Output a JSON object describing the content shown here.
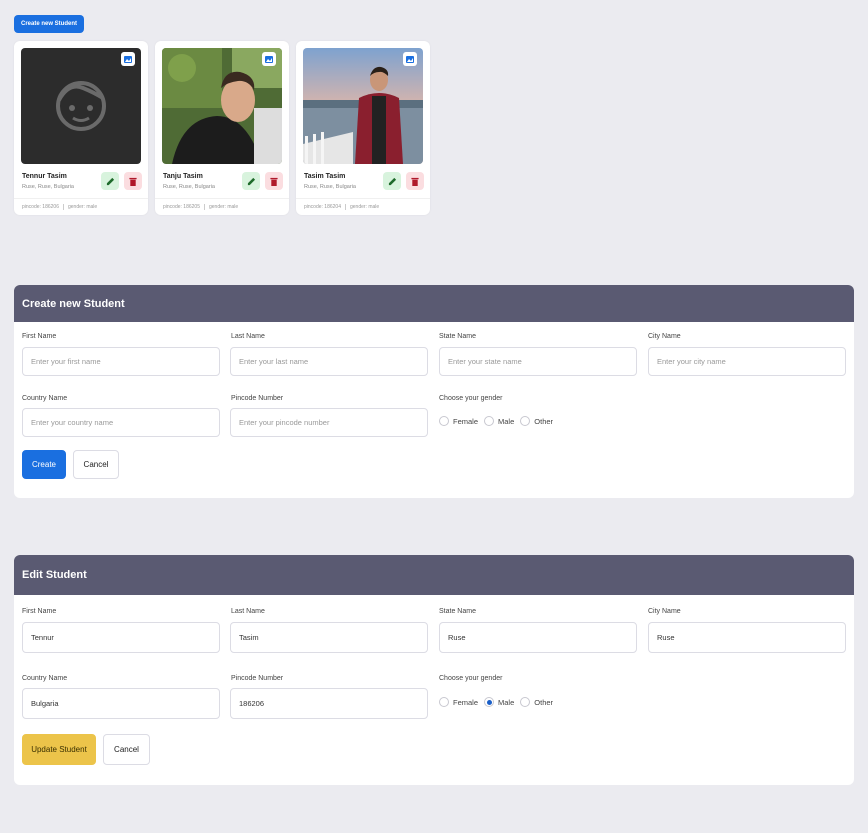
{
  "header_button": "Create new Student",
  "students": [
    {
      "name": "Tennur Tasim",
      "address": "Ruse, Ruse, Bulgaria",
      "pincode": "pincode: 186206",
      "gender": "gender: male"
    },
    {
      "name": "Tanju Tasim",
      "address": "Ruse, Ruse, Bulgaria",
      "pincode": "pincode: 186205",
      "gender": "gender: male"
    },
    {
      "name": "Tasim Tasim",
      "address": "Ruse, Ruse, Bulgaria",
      "pincode": "pincode: 186204",
      "gender": "gender: male"
    }
  ],
  "create_form": {
    "title": "Create new Student",
    "first_name": {
      "label": "First Name",
      "placeholder": "Enter your first name",
      "value": ""
    },
    "last_name": {
      "label": "Last Name",
      "placeholder": "Enter your last name",
      "value": ""
    },
    "state_name": {
      "label": "State Name",
      "placeholder": "Enter your state name",
      "value": ""
    },
    "city_name": {
      "label": "City Name",
      "placeholder": "Enter your city name",
      "value": ""
    },
    "country_name": {
      "label": "Country Name",
      "placeholder": "Enter your country name",
      "value": ""
    },
    "pincode": {
      "label": "Pincode Number",
      "placeholder": "Enter your pincode number",
      "value": ""
    },
    "gender_label": "Choose your gender",
    "gender_options": [
      "Female",
      "Male",
      "Other"
    ],
    "gender_selected": "",
    "submit_label": "Create",
    "cancel_label": "Cancel"
  },
  "edit_form": {
    "title": "Edit Student",
    "first_name": {
      "label": "First Name",
      "value": "Tennur"
    },
    "last_name": {
      "label": "Last Name",
      "value": "Tasim"
    },
    "state_name": {
      "label": "State Name",
      "value": "Ruse"
    },
    "city_name": {
      "label": "City Name",
      "value": "Ruse"
    },
    "country_name": {
      "label": "Country Name",
      "value": "Bulgaria"
    },
    "pincode": {
      "label": "Pincode Number",
      "value": "186206"
    },
    "gender_label": "Choose your gender",
    "gender_options": [
      "Female",
      "Male",
      "Other"
    ],
    "gender_selected": "Male",
    "submit_label": "Update Student",
    "cancel_label": "Cancel"
  },
  "colors": {
    "primary": "#1a6fe0",
    "panel_header": "#5a5a72",
    "warning": "#ecc44a",
    "page_bg": "#ebebf0"
  }
}
